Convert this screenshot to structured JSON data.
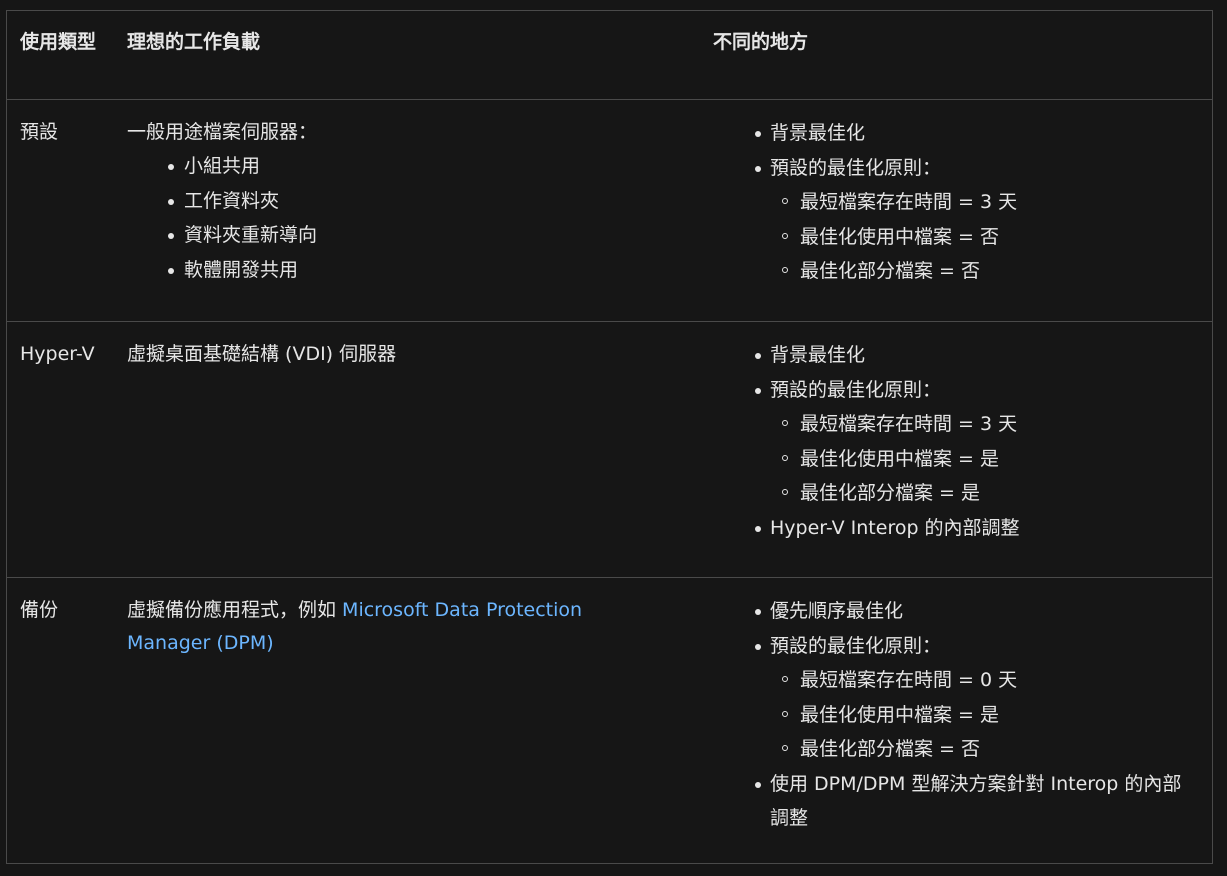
{
  "header": {
    "col_type": "使用類型",
    "col_workload": "理想的工作負載",
    "col_diff": "不同的地方"
  },
  "rows": [
    {
      "type": "預設",
      "workload_text": "一般用途檔案伺服器：",
      "workload_items": [
        "小組共用",
        "工作資料夾",
        "資料夾重新導向",
        "軟體開發共用"
      ],
      "diff": [
        {
          "label": "背景最佳化"
        },
        {
          "label": "預設的最佳化原則：",
          "sub": [
            "最短檔案存在時間 = 3 天",
            "最佳化使用中檔案 = 否",
            "最佳化部分檔案 = 否"
          ]
        }
      ]
    },
    {
      "type": "Hyper-V",
      "workload_text": "虛擬桌面基礎結構 (VDI) 伺服器",
      "diff": [
        {
          "label": "背景最佳化"
        },
        {
          "label": "預設的最佳化原則：",
          "sub": [
            "最短檔案存在時間 = 3 天",
            "最佳化使用中檔案 = 是",
            "最佳化部分檔案 = 是"
          ]
        },
        {
          "label": "Hyper-V Interop 的內部調整"
        }
      ]
    },
    {
      "type": "備份",
      "workload_text": "虛擬備份應用程式，例如 ",
      "workload_link": "Microsoft Data Protection Manager (DPM)",
      "diff": [
        {
          "label": "優先順序最佳化"
        },
        {
          "label": "預設的最佳化原則：",
          "sub": [
            "最短檔案存在時間 = 0 天",
            "最佳化使用中檔案 = 是",
            "最佳化部分檔案 = 否"
          ]
        },
        {
          "label": "使用 DPM/DPM 型解決方案針對 Interop 的內部調整"
        }
      ]
    }
  ]
}
